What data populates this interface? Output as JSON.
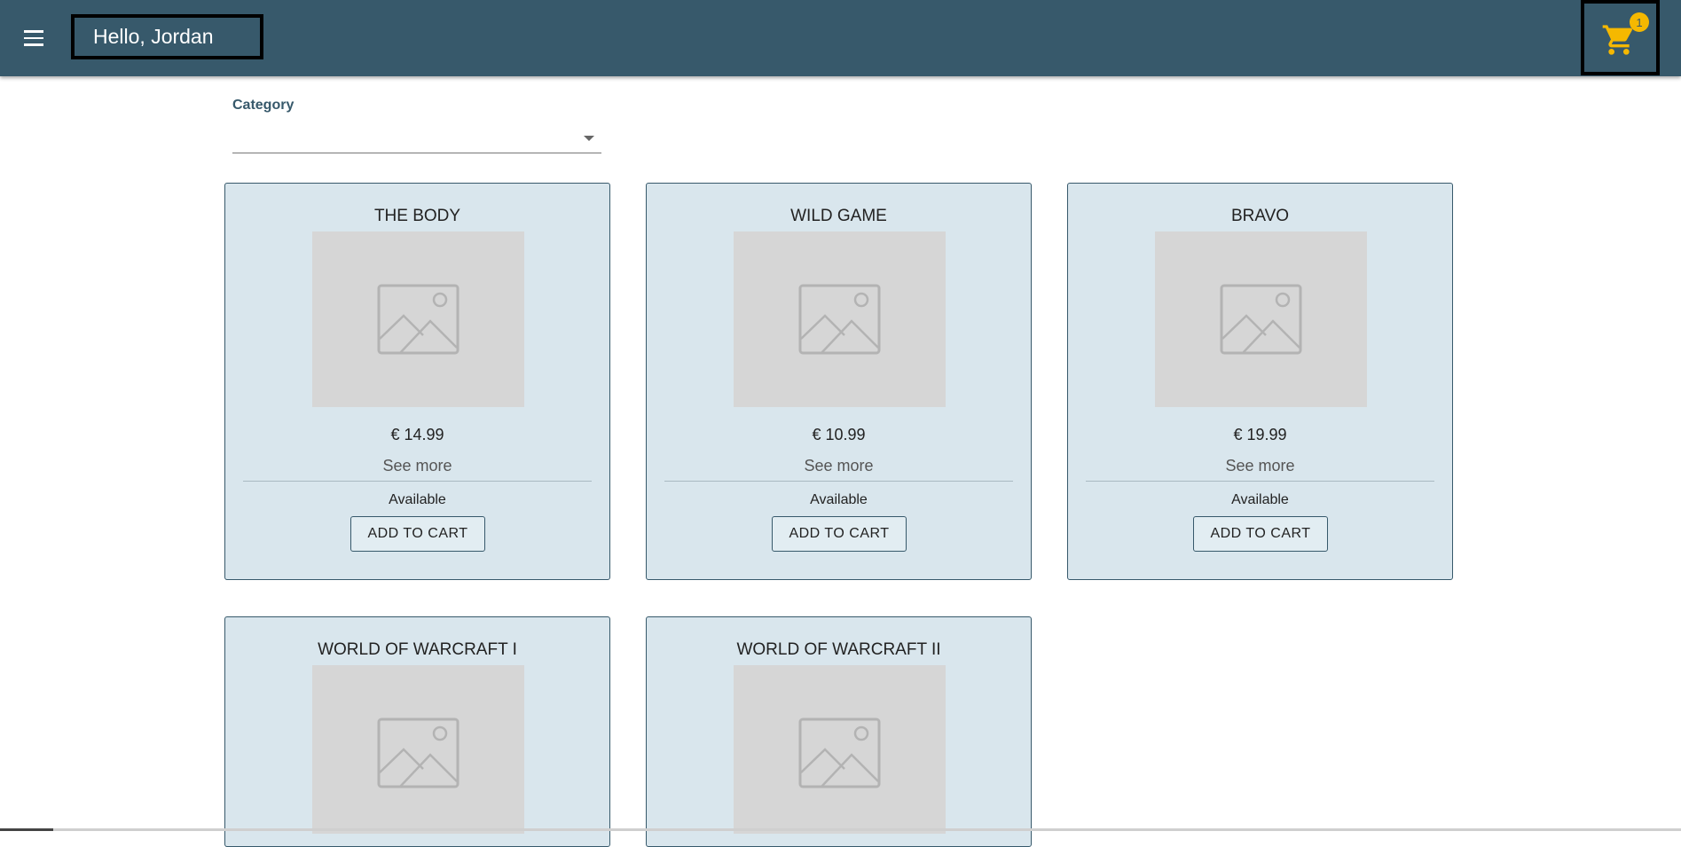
{
  "header": {
    "greeting": "Hello, Jordan",
    "menu_icon": "hamburger-menu-icon",
    "cart_icon": "shopping-cart-icon",
    "cart_count": "1",
    "background_color": "#37596b",
    "accent_color": "#f5b800"
  },
  "filter": {
    "label": "Category",
    "selected": ""
  },
  "products": [
    {
      "title": "THE BODY",
      "price": "€ 14.99",
      "see_more": "See more",
      "status": "Available",
      "button": "ADD TO CART"
    },
    {
      "title": "WILD GAME",
      "price": "€ 10.99",
      "see_more": "See more",
      "status": "Available",
      "button": "ADD TO CART"
    },
    {
      "title": "BRAVO",
      "price": "€ 19.99",
      "see_more": "See more",
      "status": "Available",
      "button": "ADD TO CART"
    },
    {
      "title": "WORLD OF WARCRAFT I"
    },
    {
      "title": "WORLD OF WARCRAFT II"
    }
  ]
}
